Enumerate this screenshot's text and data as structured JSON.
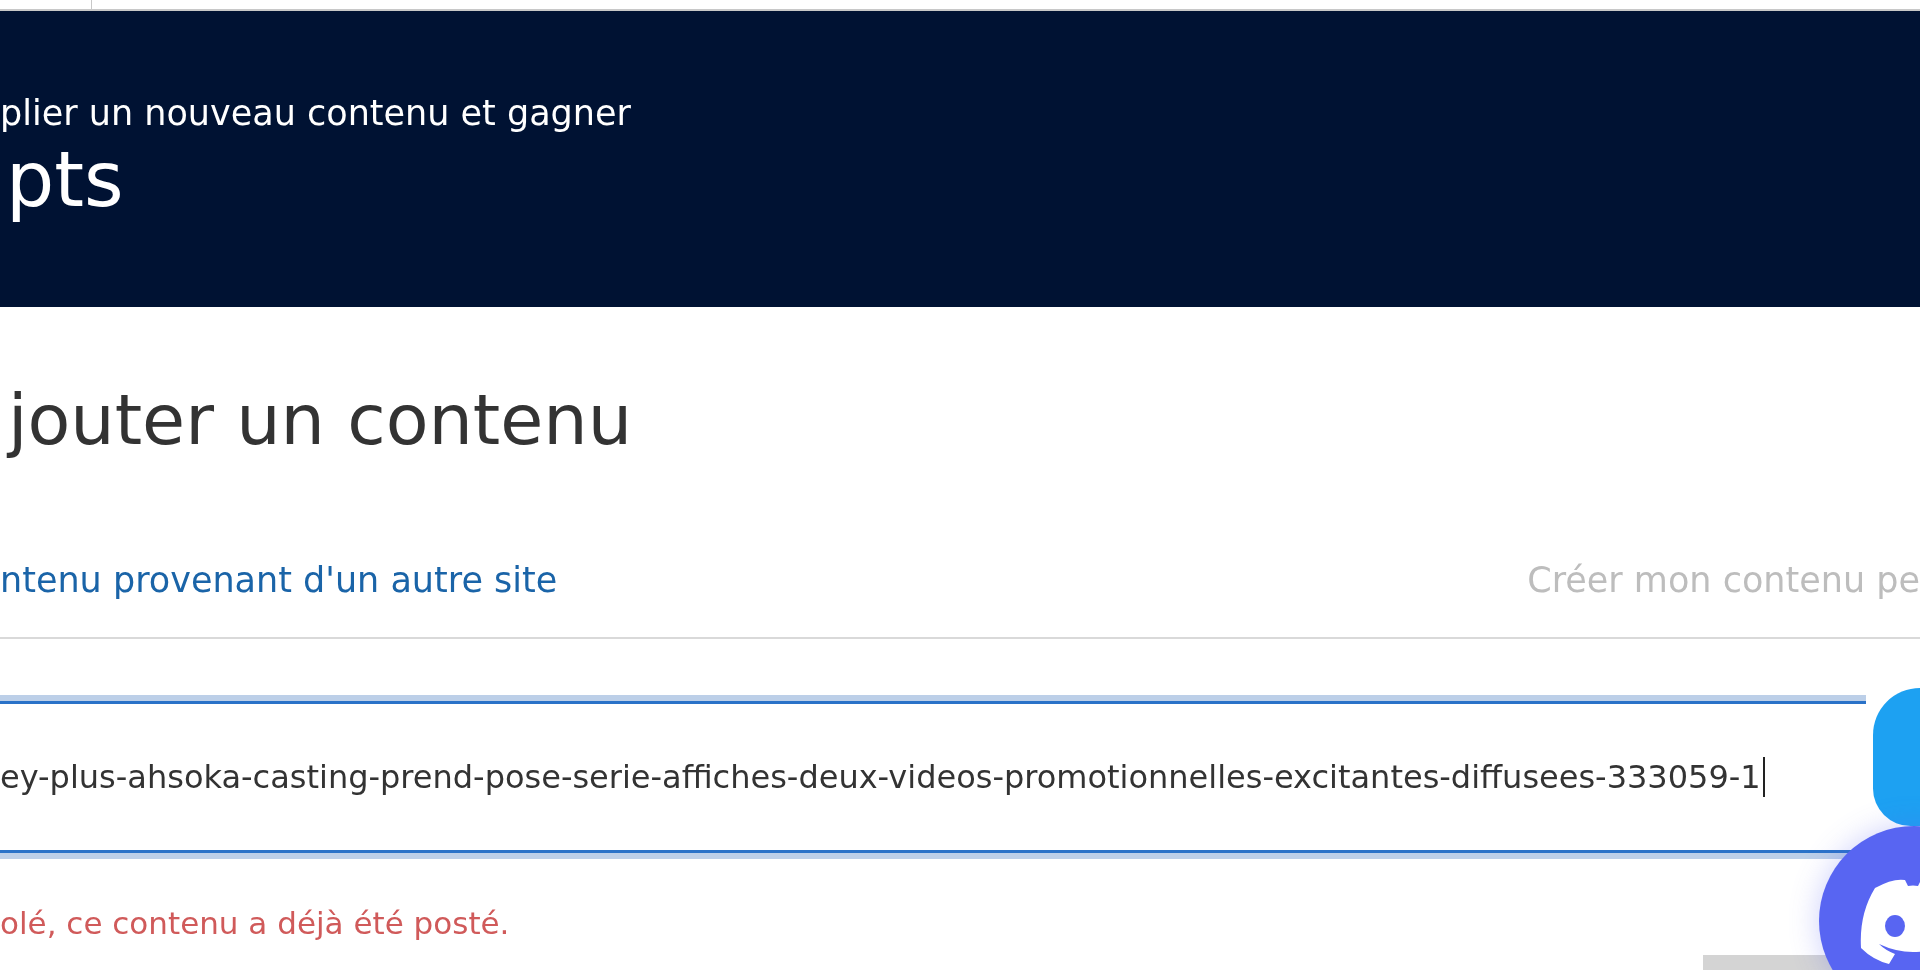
{
  "banner": {
    "subtitle": "plier un nouveau contenu et gagner",
    "points": "pts"
  },
  "heading": "jouter un contenu",
  "tabs": [
    {
      "label": "ntenu provenant d'un autre site",
      "selected": true
    },
    {
      "label": "Créer mon contenu pe",
      "selected": false
    }
  ],
  "url_field": {
    "value": "ey-plus-ahsoka-casting-prend-pose-serie-affiches-deux-videos-promotionnelles-excitantes-diffusees-333059-1",
    "focused": true
  },
  "error": "olé, ce contenu a déjà été posté."
}
